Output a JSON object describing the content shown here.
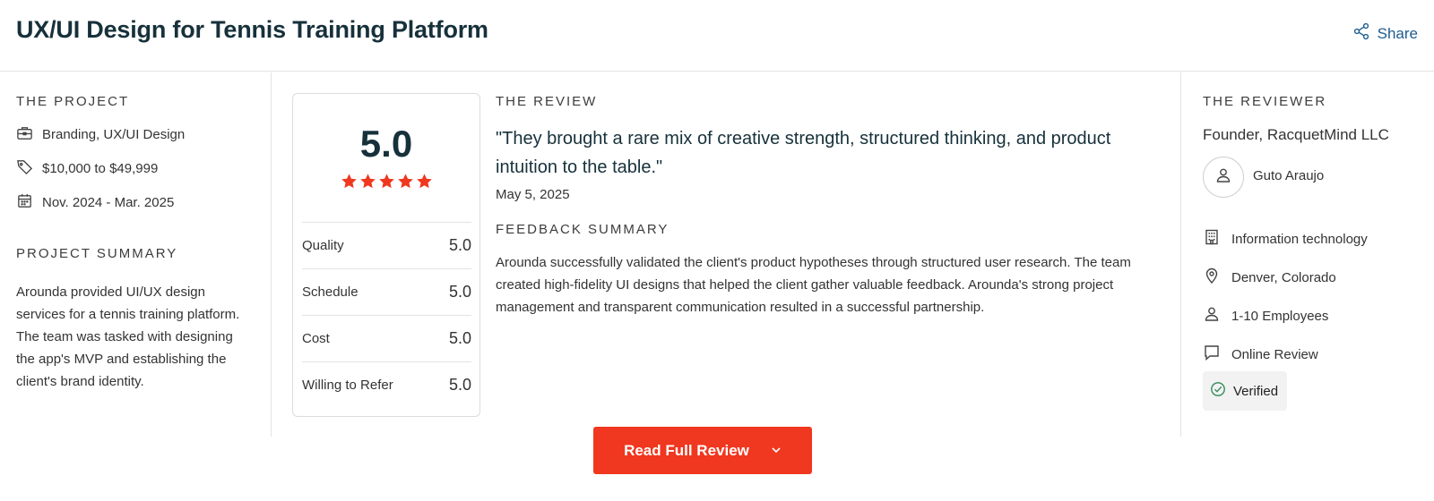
{
  "header": {
    "title": "UX/UI Design for Tennis Training Platform",
    "share_label": "Share"
  },
  "project": {
    "section_label": "THE PROJECT",
    "service": "Branding, UX/UI Design",
    "budget": "$10,000 to $49,999",
    "dates": "Nov. 2024 - Mar. 2025",
    "summary_label": "PROJECT SUMMARY",
    "summary_text": "Arounda provided UI/UX design services for a tennis training platform. The team was tasked with designing the app's MVP and establishing the client's brand identity."
  },
  "rating": {
    "overall": "5.0",
    "stars": 5,
    "rows": [
      {
        "label": "Quality",
        "value": "5.0"
      },
      {
        "label": "Schedule",
        "value": "5.0"
      },
      {
        "label": "Cost",
        "value": "5.0"
      },
      {
        "label": "Willing to Refer",
        "value": "5.0"
      }
    ]
  },
  "review": {
    "section_label": "THE REVIEW",
    "quote": "\"They brought a rare mix of creative strength, structured thinking, and product intuition to the table.\"",
    "date": "May 5, 2025",
    "feedback_label": "FEEDBACK SUMMARY",
    "feedback_text": "Arounda successfully validated the client's product hypotheses through structured user research. The team created high-fidelity UI designs that helped the client gather valuable feedback. Arounda's strong project management and transparent communication resulted in a successful partnership."
  },
  "reviewer": {
    "section_label": "THE REVIEWER",
    "title": "Founder, RacquetMind LLC",
    "name": "Guto Araujo",
    "industry": "Information technology",
    "location": "Denver, Colorado",
    "size": "1-10 Employees",
    "review_type": "Online Review",
    "verified": "Verified"
  },
  "cta": {
    "label": "Read Full Review"
  },
  "colors": {
    "accent": "#f0371f",
    "link": "#1e5c8f",
    "verified_green": "#2e8b57",
    "heading": "#17313b"
  },
  "icons": [
    "share-icon",
    "briefcase-icon",
    "tag-icon",
    "calendar-icon",
    "star-icon",
    "user-icon",
    "building-icon",
    "location-pin-icon",
    "chat-bubble-icon",
    "check-circle-icon",
    "chevron-down-icon"
  ]
}
